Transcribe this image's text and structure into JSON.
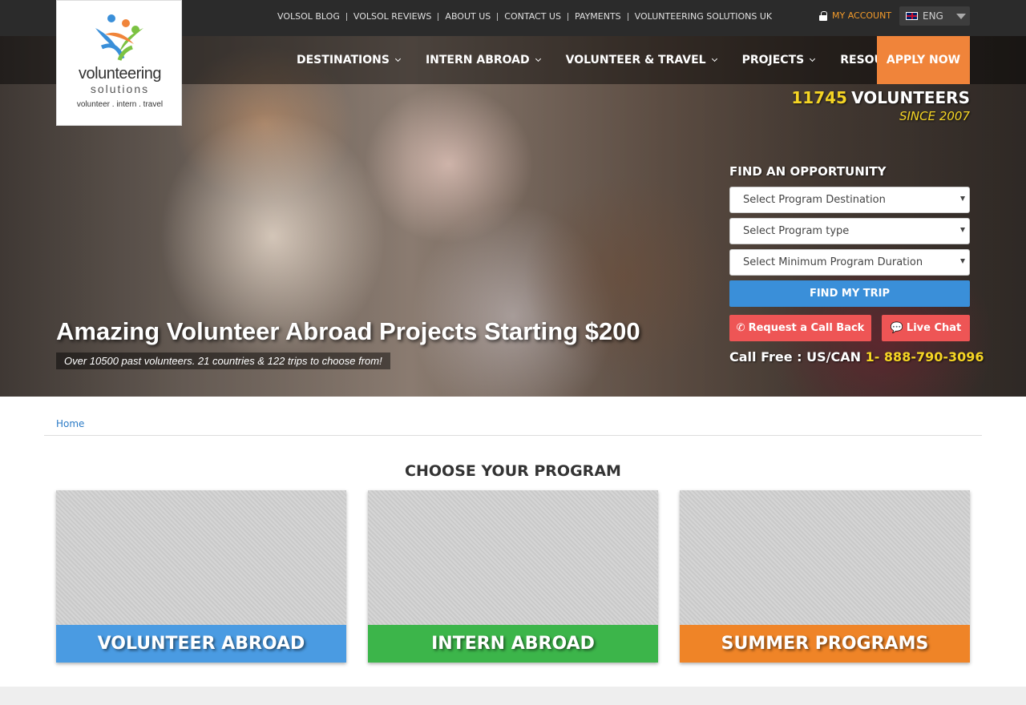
{
  "topbar": {
    "links": [
      "VOLSOL BLOG",
      "VOLSOL REVIEWS",
      "ABOUT US",
      "CONTACT US",
      "PAYMENTS",
      "VOLUNTEERING SOLUTIONS UK"
    ],
    "account": "MY ACCOUNT",
    "language": "ENG"
  },
  "logo": {
    "line1": "volunteering",
    "line2": "solutions",
    "tagline": "volunteer . intern . travel"
  },
  "nav": {
    "items": [
      "DESTINATIONS",
      "INTERN ABROAD",
      "VOLUNTEER & TRAVEL",
      "PROJECTS",
      "RESOURCES"
    ],
    "apply": "APPLY NOW"
  },
  "counter": {
    "number": "11745",
    "label": "VOLUNTEERS",
    "since": "SINCE 2007"
  },
  "finder": {
    "title": "FIND AN OPPORTUNITY",
    "destination": "Select Program Destination",
    "type": "Select Program type",
    "duration": "Select Minimum Program Duration",
    "button": "FIND MY TRIP",
    "callback": "Request a Call Back",
    "livechat": "Live Chat",
    "call_prefix": "Call Free : US/CAN",
    "phone": "1- 888-790-3096"
  },
  "hero": {
    "headline": "Amazing Volunteer Abroad Projects Starting $200",
    "subline": "Over 10500 past volunteers. 21 countries & 122 trips to choose from!"
  },
  "breadcrumb": "Home",
  "programs": {
    "title": "CHOOSE YOUR PROGRAM",
    "cards": [
      "VOLUNTEER ABROAD",
      "INTERN ABROAD",
      "SUMMER PROGRAMS"
    ]
  },
  "colors": {
    "accent_orange": "#f0843a",
    "yellow": "#f5d524",
    "blue": "#4a9be2",
    "green": "#3cb54a",
    "red": "#ee5555"
  }
}
